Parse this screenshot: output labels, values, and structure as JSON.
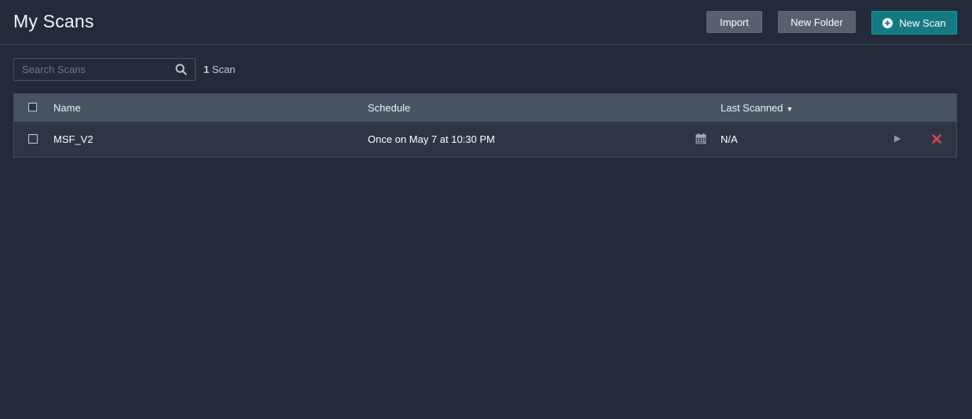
{
  "header": {
    "title": "My Scans",
    "import_label": "Import",
    "new_folder_label": "New Folder",
    "new_scan_label": "New Scan"
  },
  "search": {
    "placeholder": "Search Scans",
    "value": ""
  },
  "scan_count": {
    "number": "1",
    "label": " Scan"
  },
  "table": {
    "columns": {
      "name": "Name",
      "schedule": "Schedule",
      "last_scanned": "Last Scanned",
      "sort_indicator": "▼"
    },
    "rows": [
      {
        "name": "MSF_V2",
        "schedule": "Once on May 7 at 10:30 PM",
        "last_scanned": "N/A"
      }
    ]
  },
  "icons": {
    "new_scan": "plus-circle-icon",
    "search": "search-icon",
    "schedule": "calendar-icon",
    "launch": "play-icon",
    "delete": "close-icon"
  },
  "colors": {
    "background": "#232b39",
    "accent": "#137a82",
    "delete": "#e0474c"
  }
}
